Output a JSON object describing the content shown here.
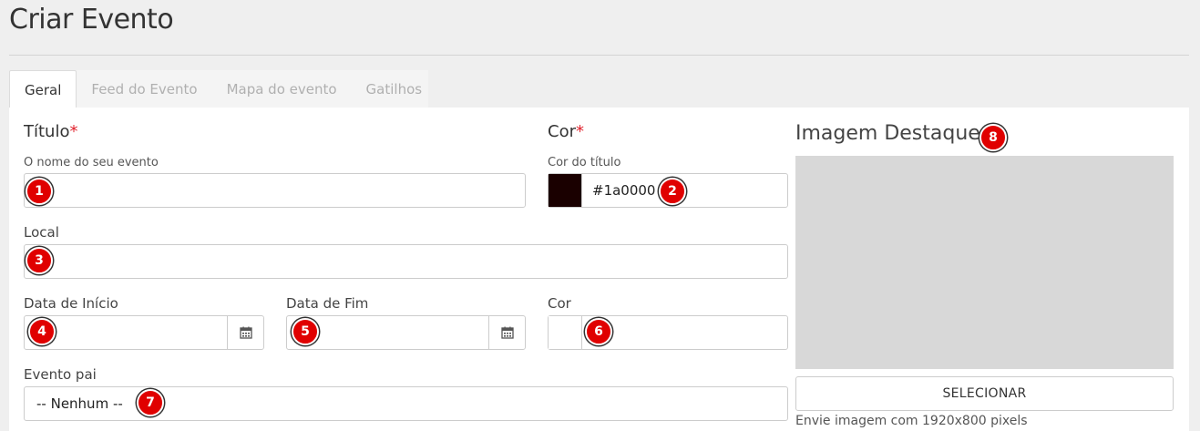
{
  "page": {
    "title": "Criar Evento"
  },
  "tabs": [
    {
      "label": "Geral",
      "active": true
    },
    {
      "label": "Feed do Evento",
      "active": false
    },
    {
      "label": "Mapa do evento",
      "active": false
    },
    {
      "label": "Gatilhos",
      "active": false
    }
  ],
  "form": {
    "titulo": {
      "label": "Título",
      "required_mark": "*",
      "hint": "O nome do seu evento",
      "value": ""
    },
    "cor_titulo": {
      "label": "Cor",
      "required_mark": "*",
      "hint": "Cor do título",
      "value": "#1a0000",
      "swatch_color": "#1a0000"
    },
    "local": {
      "label": "Local",
      "value": ""
    },
    "data_inicio": {
      "label": "Data de Início",
      "value": "",
      "icon": "calendar-icon"
    },
    "data_fim": {
      "label": "Data de Fim",
      "value": "",
      "icon": "calendar-icon"
    },
    "cor": {
      "label": "Cor",
      "value": ""
    },
    "evento_pai": {
      "label": "Evento pai",
      "selected": "-- Nenhum --"
    }
  },
  "featured_image": {
    "heading": "Imagem Destaque",
    "button_label": "SELECIONAR",
    "hint": "Envie imagem com 1920x800 pixels"
  },
  "markers": [
    "1",
    "2",
    "3",
    "4",
    "5",
    "6",
    "7",
    "8"
  ],
  "colors": {
    "required": "#e0222d",
    "marker": "#e00000",
    "placeholder": "#d8d8d8"
  }
}
